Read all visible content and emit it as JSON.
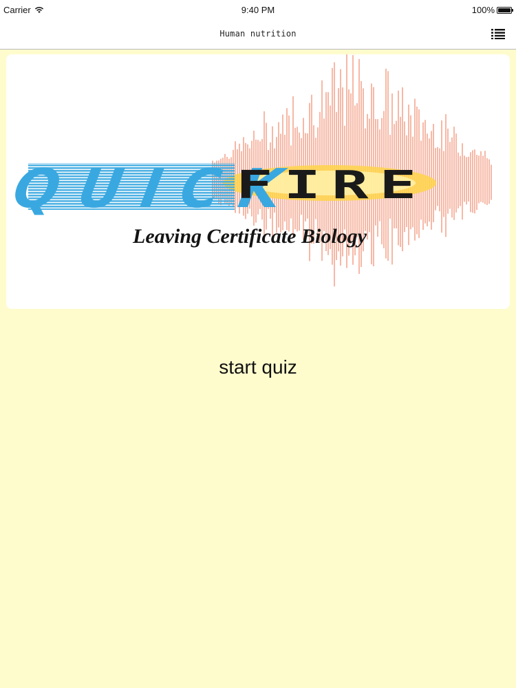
{
  "status_bar": {
    "carrier": "Carrier",
    "time": "9:40 PM",
    "battery": "100%",
    "icons": [
      "wifi-icon",
      "battery-icon"
    ]
  },
  "nav": {
    "title": "Human nutrition",
    "menu_icon": "list-icon"
  },
  "banner": {
    "logo_part1": "QUICK",
    "logo_part2": "FIRE",
    "subtitle": "Leaving Certificate Biology"
  },
  "main": {
    "start_label": "start quiz"
  },
  "colors": {
    "background": "#fefccd",
    "quick_blue": "#3aa8e0",
    "fire_orange": "#f08a6a",
    "fire_glow": "#ffd34a"
  }
}
